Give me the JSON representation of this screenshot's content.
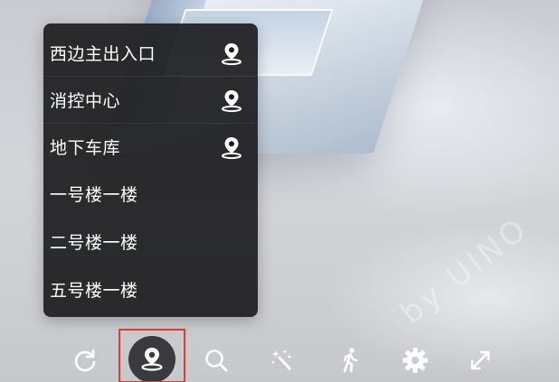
{
  "location_menu": {
    "items": [
      {
        "label": "西边主出入口",
        "has_pin": true
      },
      {
        "label": "消控中心",
        "has_pin": true
      },
      {
        "label": "地下车库",
        "has_pin": true
      },
      {
        "label": "一号楼一楼",
        "has_pin": false
      },
      {
        "label": "二号楼一楼",
        "has_pin": false
      },
      {
        "label": "五号楼一楼",
        "has_pin": false
      }
    ]
  },
  "toolbar": {
    "buttons": [
      {
        "icon": "refresh-icon",
        "active": false
      },
      {
        "icon": "location-pin-icon",
        "active": true
      },
      {
        "icon": "search-icon",
        "active": false
      },
      {
        "icon": "magic-wand-icon",
        "active": false
      },
      {
        "icon": "walk-icon",
        "active": false
      },
      {
        "icon": "gear-icon",
        "active": false
      },
      {
        "icon": "fullscreen-icon",
        "active": false
      }
    ]
  },
  "watermark": "by UINO",
  "colors": {
    "menu_background": "#1c1c1e",
    "menu_text": "#ffffff",
    "active_highlight_border": "#e23b32",
    "active_button_fill": "#3a3b3e",
    "toolbar_icon": "#ffffff"
  }
}
